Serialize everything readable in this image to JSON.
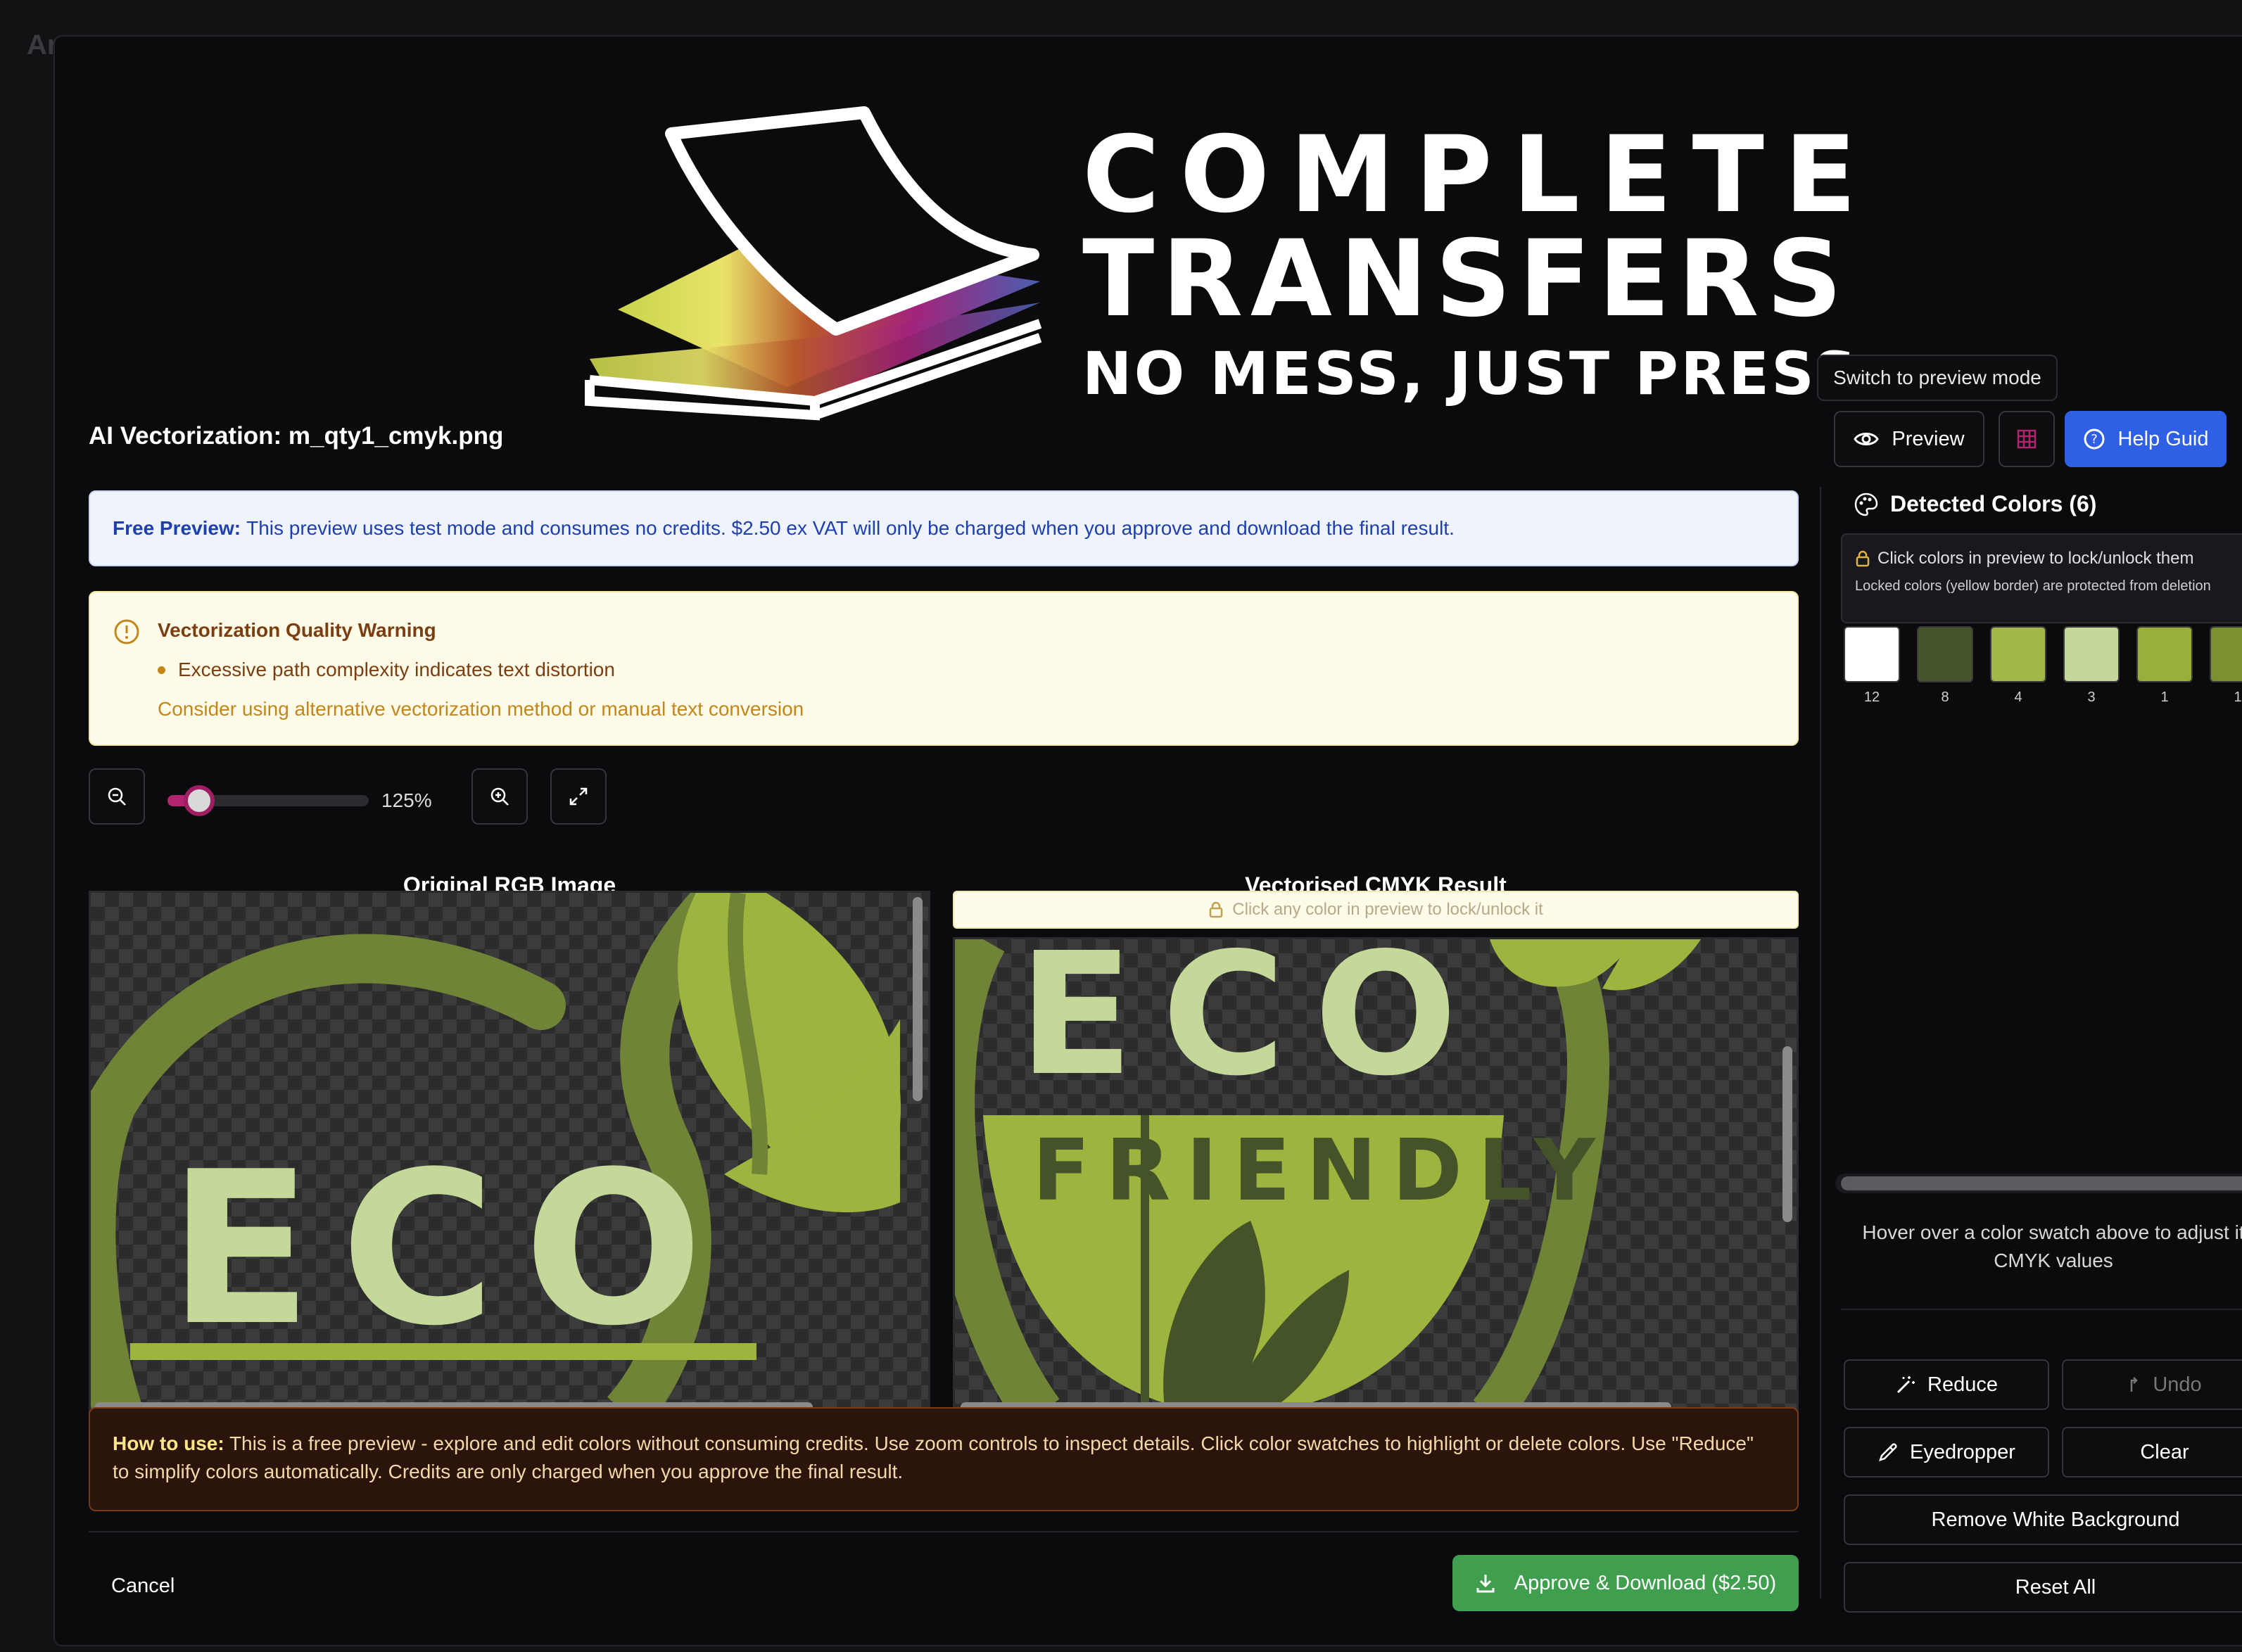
{
  "background": {
    "title": "Ar"
  },
  "logo": {
    "line1": "COMPLETE",
    "line2": "TRANSFERS",
    "line3": "NO MESS, JUST PRESS"
  },
  "dialog": {
    "title": "AI Vectorization: m_qty1_cmyk.png"
  },
  "toolbar": {
    "tooltip": "Switch to preview mode",
    "preview_label": "Preview",
    "help_label": "Help Guid"
  },
  "free_preview": {
    "bold": "Free Preview:",
    "text": "This preview uses test mode and consumes no credits. $2.50 ex VAT will only be charged when you approve and download the final result."
  },
  "warning": {
    "title": "Vectorization Quality Warning",
    "bullet": "Excessive path complexity indicates text distortion",
    "hint": "Consider using alternative vectorization method or manual text conversion"
  },
  "zoom": {
    "label": "125%",
    "value_fraction": 0.08
  },
  "original": {
    "title": "Original RGB Image",
    "art_text": "ECO"
  },
  "result": {
    "title": "Vectorised CMYK Result",
    "lock_hint": "Click any color in preview to lock/unlock it",
    "art_text_1": "ECO",
    "art_text_2": "FRIENDLY"
  },
  "howto": {
    "bold": "How to use:",
    "text": "This is a free preview - explore and edit colors without consuming credits. Use zoom controls to inspect details. Click color swatches to highlight or delete colors. Use \"Reduce\" to simplify colors automatically. Credits are only charged when you approve the final result."
  },
  "footer": {
    "cancel_label": "Cancel",
    "approve_label": "Approve & Download ($2.50)"
  },
  "side": {
    "title": "Detected Colors (6)",
    "lock_line1": "Click colors in preview to lock/unlock them",
    "lock_line2": "Locked colors (yellow border) are protected from deletion",
    "swatches": [
      {
        "color": "#ffffff",
        "count": "12"
      },
      {
        "color": "#445428",
        "count": "8"
      },
      {
        "color": "#a2b84a",
        "count": "4"
      },
      {
        "color": "#c4d89a",
        "count": "3"
      },
      {
        "color": "#98b03a",
        "count": "1"
      },
      {
        "color": "#7b9030",
        "count": "1"
      }
    ],
    "hover_hint": "Hover over a color swatch above to adjust it CMYK values",
    "reduce_label": "Reduce",
    "undo_label": "Undo",
    "eyedropper_label": "Eyedropper",
    "clear_label": "Clear",
    "remove_bg_label": "Remove White Background",
    "reset_label": "Reset All"
  }
}
